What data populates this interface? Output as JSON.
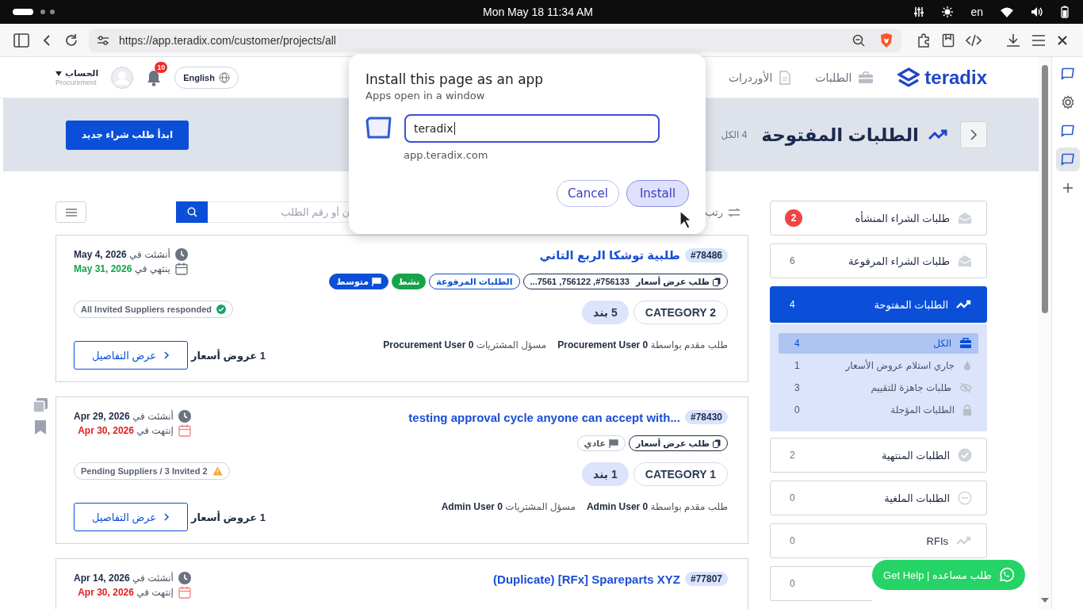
{
  "system_bar": {
    "clock": "Mon May 18  11:34 AM",
    "language": "en"
  },
  "browser": {
    "url": "https://app.teradix.com/customer/projects/all",
    "side_panel": [
      {
        "selected": false
      },
      {
        "selected": false
      },
      {
        "selected": false
      },
      {
        "selected": true
      }
    ]
  },
  "header": {
    "logo": "teradix",
    "nav": [
      {
        "label": "الطلبات"
      },
      {
        "label": "الأوردرات"
      }
    ],
    "language_button": "English",
    "notifications": "10",
    "account": {
      "label": "الحساب",
      "role": "Procurement"
    }
  },
  "banner": {
    "title": "الطلبات المفتوحة",
    "count": "4 الكل",
    "new_button": "ابدأ طلب شراء جديد"
  },
  "sidebar": {
    "items": [
      {
        "label": "طلبات الشراء المنشأه",
        "count": "2",
        "alert": true,
        "selected": false
      },
      {
        "label": "طلبات الشراء المرفوعة",
        "count": "6",
        "alert": false,
        "selected": false
      },
      {
        "label": "الطلبات المفتوحة",
        "count": "4",
        "alert": false,
        "selected": true,
        "children": [
          {
            "label": "الكل",
            "count": "4",
            "selected": true
          },
          {
            "label": "جاري استلام عروض الأسعار",
            "count": "1",
            "selected": false
          },
          {
            "label": "طلبات جاهزة للتقييم",
            "count": "3",
            "selected": false
          },
          {
            "label": "الطلبات المؤجلة",
            "count": "0",
            "selected": false
          }
        ]
      },
      {
        "label": "الطلبات المنتهية",
        "count": "2",
        "alert": false,
        "selected": false
      },
      {
        "label": "الطلبات الملغية",
        "count": "0",
        "alert": false,
        "selected": false
      },
      {
        "label": "RFIs",
        "count": "0",
        "alert": false,
        "selected": false
      },
      {
        "count": "0",
        "alert": false,
        "selected": false
      }
    ]
  },
  "toolbar": {
    "sort_label": "رتب",
    "search": {
      "placeholder": "ن أو رقم الطلب"
    }
  },
  "cards": [
    {
      "id": "#78486",
      "title": "طلبية توشكا الربع التاني",
      "quick_actions": false,
      "tags": [
        {
          "kind": "rfq",
          "label": "طلب عرض أسعار",
          "refs": "#756133, 756122, 7561..."
        },
        {
          "kind": "stage",
          "label": "الطلبات المرفوعة"
        },
        {
          "kind": "status",
          "label": "نشط"
        },
        {
          "kind": "priority",
          "label": "متوسط",
          "filled": true
        }
      ],
      "category": "CATEGORY 2",
      "items": "5 بند",
      "requested_by_label": "طلب مقدم بواسطة",
      "requested_by": "Procurement User 0",
      "officer_label": "مسؤل المشتريات",
      "officer": "Procurement User 0",
      "created_label": "أنشئت في",
      "created": "May 4, 2026",
      "ends_label": "ينتهي في",
      "ends": "May 31, 2026",
      "overdue": false,
      "suppliers": {
        "kind": "done",
        "text": "All Invited Suppliers responded"
      },
      "offers": "1 عروض أسعار",
      "details_button": "عرض التفاصيل"
    },
    {
      "id": "#78430",
      "title": "testing approval cycle anyone can accept with...",
      "quick_actions": true,
      "tags": [
        {
          "kind": "rfq",
          "label": "طلب عرض أسعار"
        },
        {
          "kind": "priority",
          "label": "عادي",
          "filled": false
        }
      ],
      "category": "CATEGORY 1",
      "items": "1 بند",
      "requested_by_label": "طلب مقدم بواسطة",
      "requested_by": "Admin User 0",
      "officer_label": "مسؤل المشتريات",
      "officer": "Admin User 0",
      "created_label": "أنشئت في",
      "created": "Apr 29, 2026",
      "ends_label": "إنتهت في",
      "ends": "Apr 30, 2026",
      "overdue": true,
      "suppliers": {
        "kind": "pending",
        "text": "Pending Suppliers / 3 Invited 2"
      },
      "offers": "1 عروض أسعار",
      "details_button": "عرض التفاصيل"
    },
    {
      "id": "#77807",
      "title": "(Duplicate) [RFx] Spareparts XYZ",
      "quick_actions": false,
      "created_label": "أنشئت في",
      "created": "Apr 14, 2026",
      "ends_label": "إنتهت في",
      "ends": "Apr 30, 2026",
      "overdue": true
    }
  ],
  "dialog": {
    "title": "Install this page as an app",
    "subtitle": "Apps open in a window",
    "name_value": "teradix",
    "origin": "app.teradix.com",
    "cancel": "Cancel",
    "install": "Install"
  },
  "help_button": {
    "label": "طلب مساعده | Get Help"
  }
}
